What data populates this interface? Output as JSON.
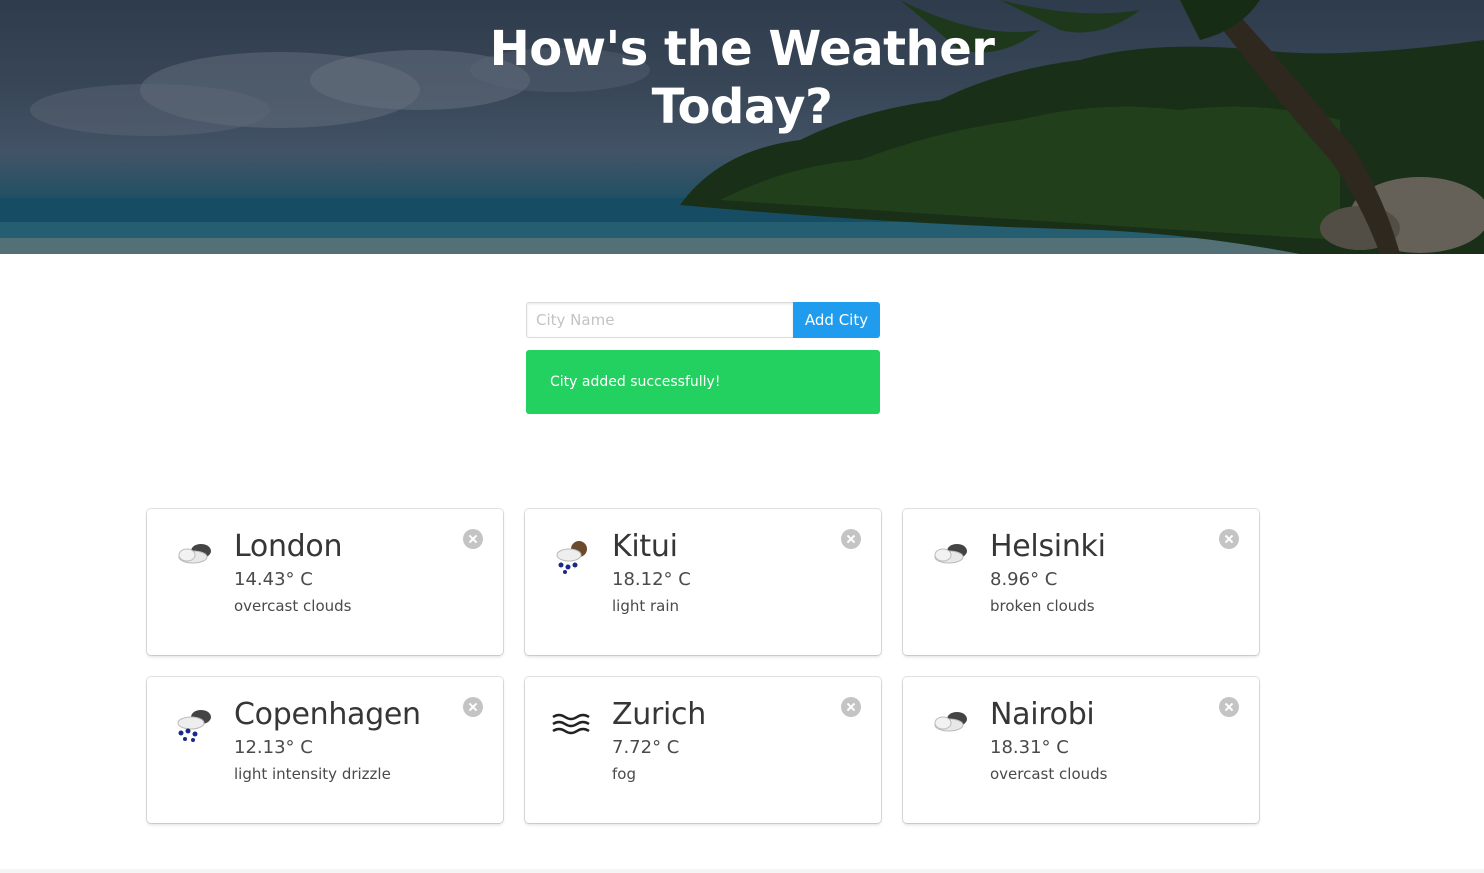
{
  "hero": {
    "title_line1": "How's the Weather",
    "title_line2": "Today?"
  },
  "form": {
    "input_placeholder": "City Name",
    "input_value": "",
    "button_label": "Add City"
  },
  "notification": {
    "message": "City added successfully!",
    "color": "#23d160"
  },
  "colors": {
    "button": "#209cee",
    "text": "#363636"
  },
  "cities": [
    {
      "name": "London",
      "temp": "14.43° C",
      "description": "overcast clouds",
      "icon": "overcast-clouds-icon"
    },
    {
      "name": "Kitui",
      "temp": "18.12° C",
      "description": "light rain",
      "icon": "light-rain-icon"
    },
    {
      "name": "Helsinki",
      "temp": "8.96° C",
      "description": "broken clouds",
      "icon": "broken-clouds-icon"
    },
    {
      "name": "Copenhagen",
      "temp": "12.13° C",
      "description": "light intensity drizzle",
      "icon": "drizzle-icon"
    },
    {
      "name": "Zurich",
      "temp": "7.72° C",
      "description": "fog",
      "icon": "fog-icon"
    },
    {
      "name": "Nairobi",
      "temp": "18.31° C",
      "description": "overcast clouds",
      "icon": "overcast-clouds-icon"
    }
  ]
}
